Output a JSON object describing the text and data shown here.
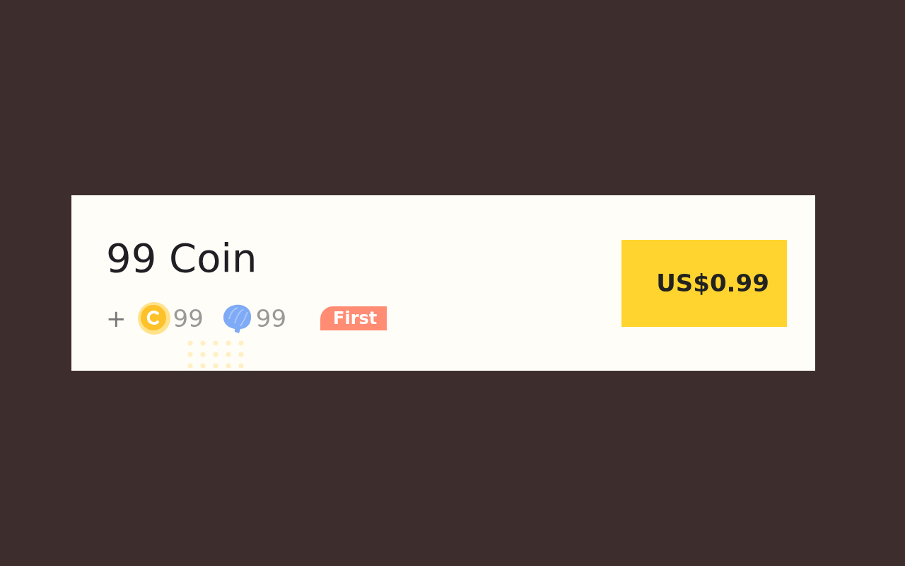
{
  "offer": {
    "title": "99 Coin",
    "plus": "+",
    "rewards": [
      {
        "kind": "coin",
        "amount": "99"
      },
      {
        "kind": "shell",
        "amount": "99"
      }
    ],
    "tag": "First",
    "price_button": "US$0.99"
  }
}
